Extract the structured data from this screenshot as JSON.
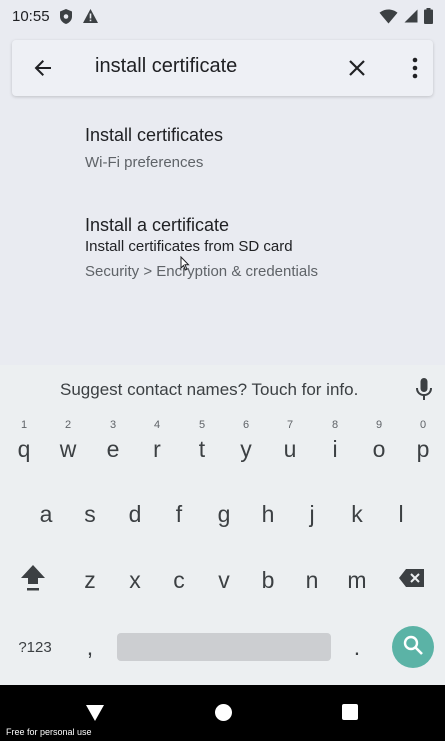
{
  "status_bar": {
    "time": "10:55"
  },
  "search": {
    "query": "install certificate"
  },
  "results": [
    {
      "title": "Install certificates",
      "subtitle": "Wi-Fi preferences"
    },
    {
      "title": "Install a certificate",
      "summary": "Install certificates from SD card",
      "subtitle": "Security > Encryption & credentials"
    }
  ],
  "keyboard": {
    "suggestion": "Suggest contact names? Touch for info.",
    "row1": [
      {
        "key": "q",
        "hint": "1"
      },
      {
        "key": "w",
        "hint": "2"
      },
      {
        "key": "e",
        "hint": "3"
      },
      {
        "key": "r",
        "hint": "4"
      },
      {
        "key": "t",
        "hint": "5"
      },
      {
        "key": "y",
        "hint": "6"
      },
      {
        "key": "u",
        "hint": "7"
      },
      {
        "key": "i",
        "hint": "8"
      },
      {
        "key": "o",
        "hint": "9"
      },
      {
        "key": "p",
        "hint": "0"
      }
    ],
    "row2": [
      "a",
      "s",
      "d",
      "f",
      "g",
      "h",
      "j",
      "k",
      "l"
    ],
    "row3": [
      "z",
      "x",
      "c",
      "v",
      "b",
      "n",
      "m"
    ],
    "symbols_label": "?123",
    "comma_label": ",",
    "period_label": ".",
    "accent_color": "#5bb3a6"
  },
  "watermark": "Free for personal use"
}
